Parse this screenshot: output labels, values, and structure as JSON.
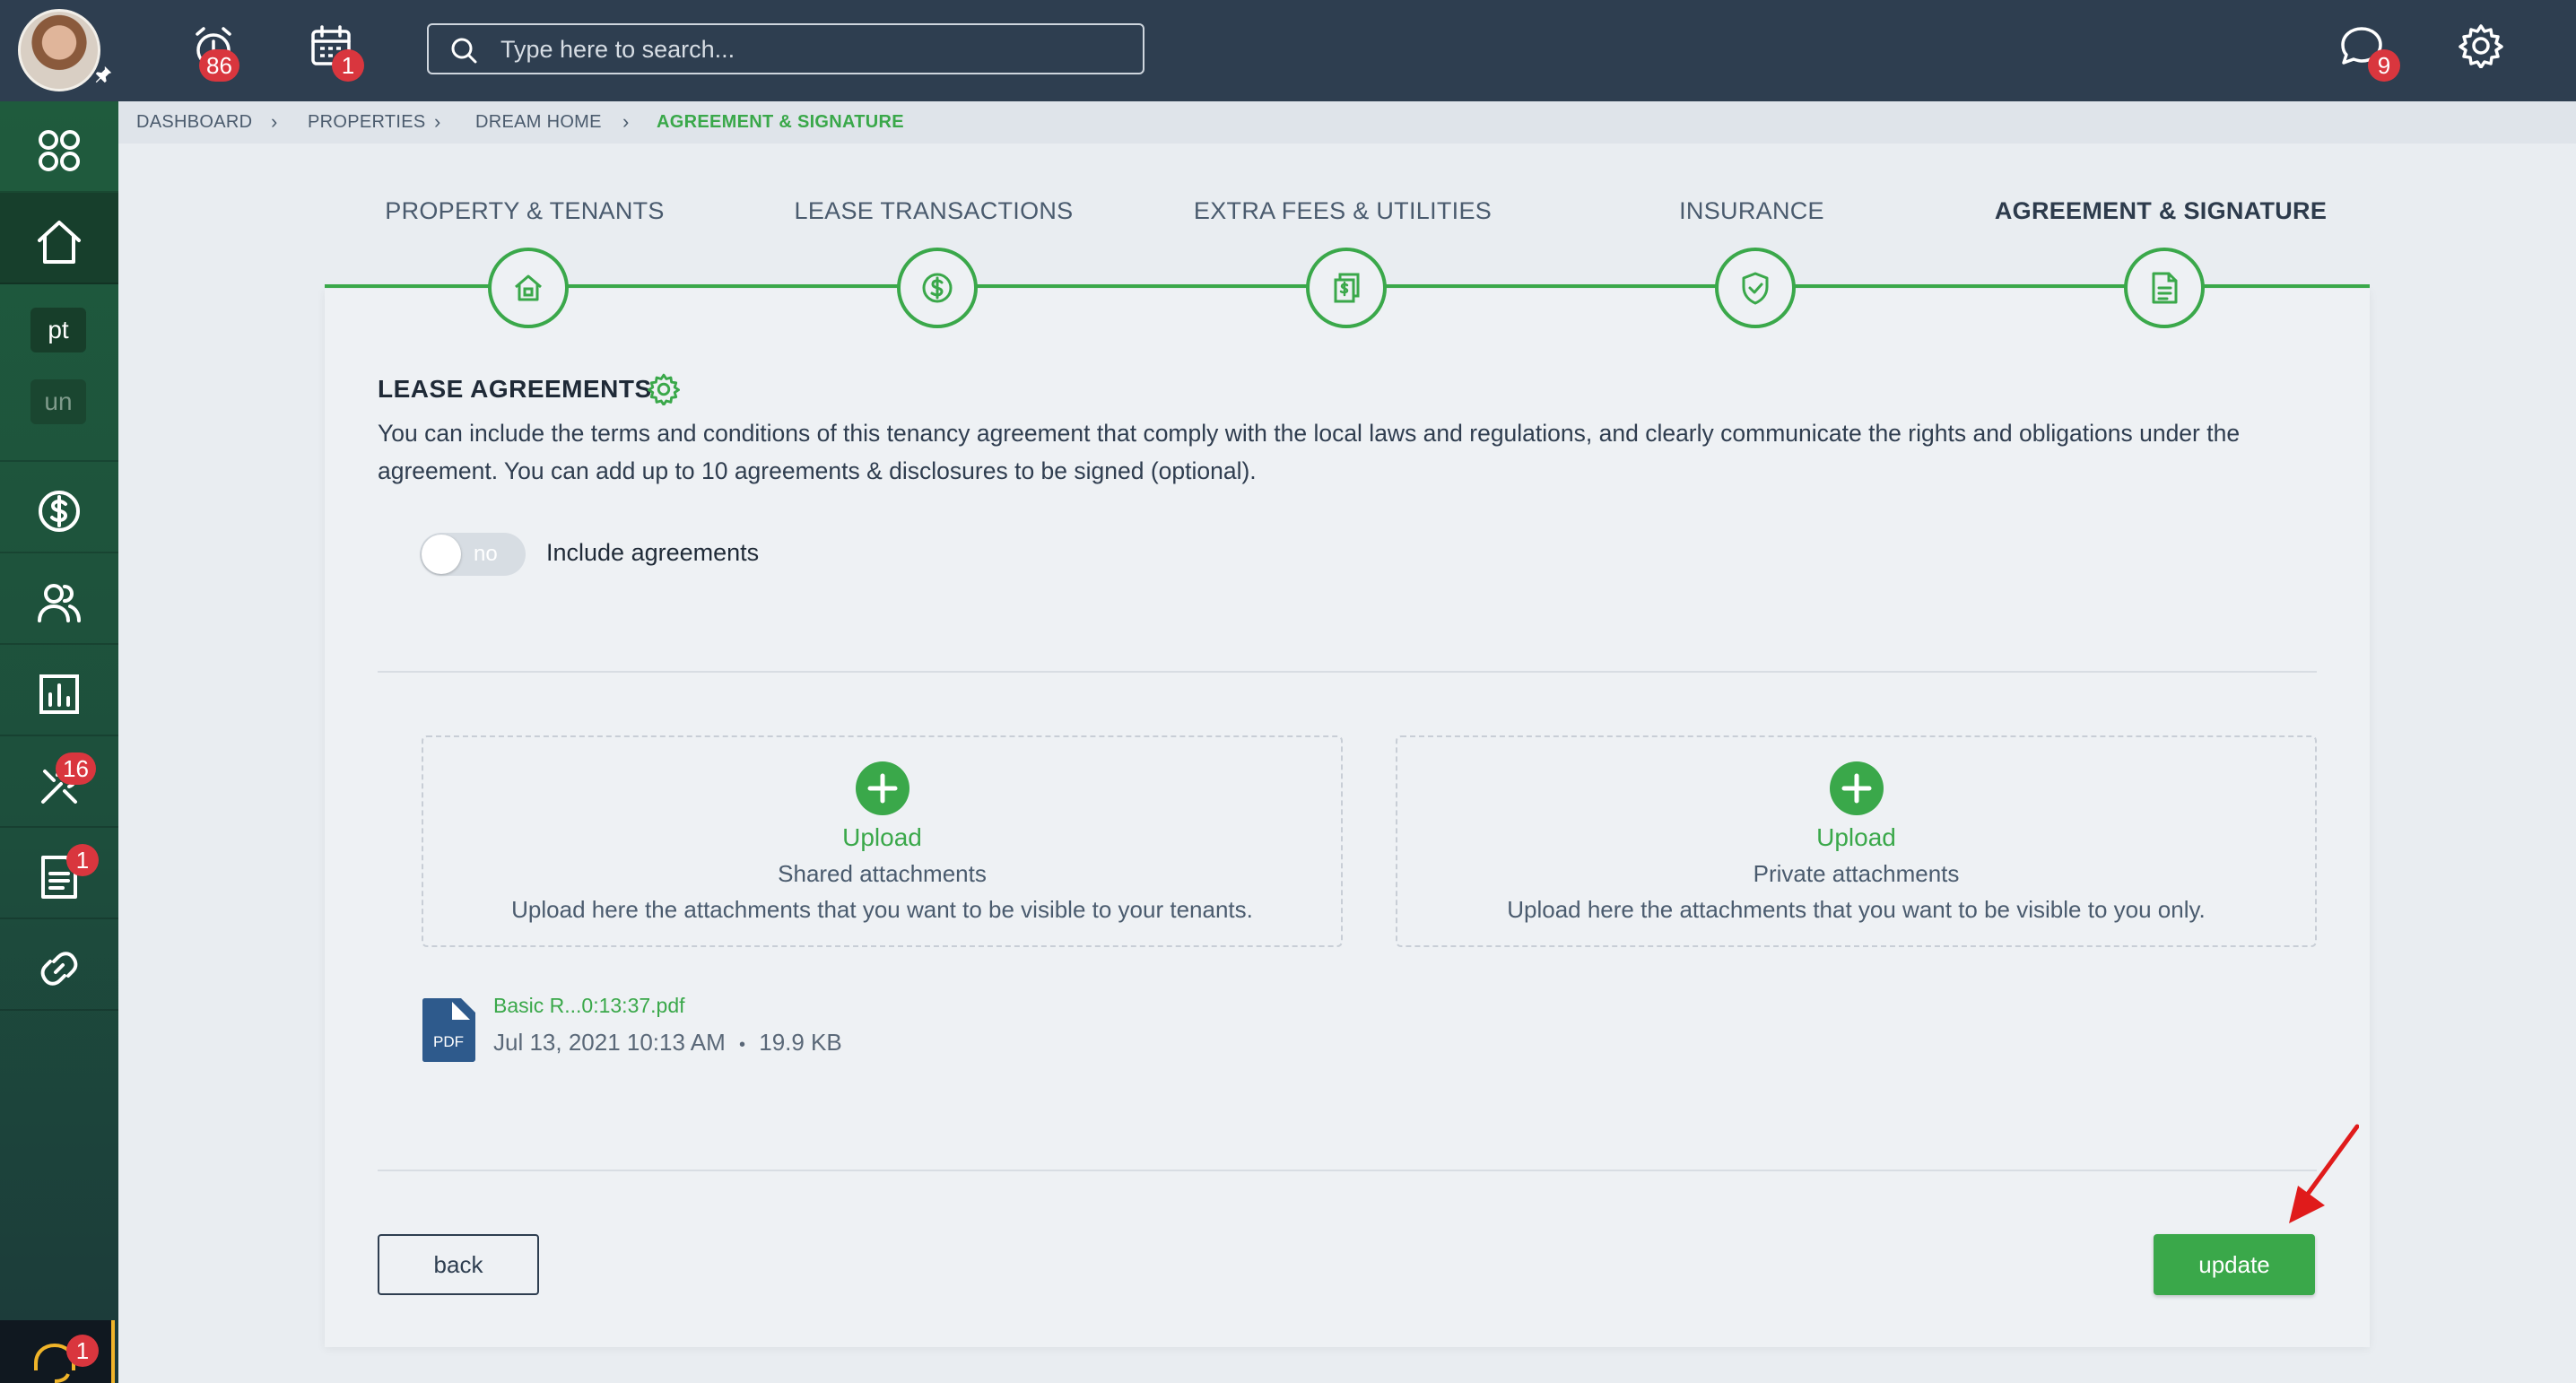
{
  "header": {
    "search_placeholder": "Type here to search...",
    "alarm_badge": "86",
    "calendar_badge": "1",
    "chat_badge": "9"
  },
  "sidebar": {
    "chip_pt": "pt",
    "chip_un": "un",
    "tools_badge": "16",
    "docs_badge": "1",
    "help_badge": "1"
  },
  "breadcrumb": {
    "items": [
      "DASHBOARD",
      "PROPERTIES",
      "DREAM HOME",
      "AGREEMENT & SIGNATURE"
    ]
  },
  "steps": [
    {
      "label": "PROPERTY & TENANTS",
      "icon": "house-icon"
    },
    {
      "label": "LEASE TRANSACTIONS",
      "icon": "dollar-icon"
    },
    {
      "label": "EXTRA FEES & UTILITIES",
      "icon": "bills-icon"
    },
    {
      "label": "INSURANCE",
      "icon": "shield-check-icon"
    },
    {
      "label": "AGREEMENT & SIGNATURE",
      "icon": "document-icon",
      "active": true
    }
  ],
  "section": {
    "title": "LEASE AGREEMENTS",
    "description": "You can include the terms and conditions of this tenancy agreement that comply with the local laws and regulations, and clearly communicate the rights and obligations under the agreement. You can add up to 10 agreements & disclosures to be signed (optional).",
    "toggle_state": "no",
    "toggle_label": "Include agreements"
  },
  "uploads": [
    {
      "action": "Upload",
      "kind": "Shared attachments",
      "hint": "Upload here the attachments that you want to be visible to your tenants."
    },
    {
      "action": "Upload",
      "kind": "Private attachments",
      "hint": "Upload here the attachments that you want to be visible to you only."
    }
  ],
  "file": {
    "type_label": "PDF",
    "name": "Basic R...0:13:37.pdf",
    "date": "Jul 13, 2021 10:13 AM",
    "separator": "•",
    "size": "19.9 KB"
  },
  "buttons": {
    "back": "back",
    "update": "update"
  },
  "colors": {
    "accent": "#3aa84a",
    "topbar": "#2e3e50",
    "badge": "#d9363e",
    "annotation_arrow": "#e01b1b"
  }
}
